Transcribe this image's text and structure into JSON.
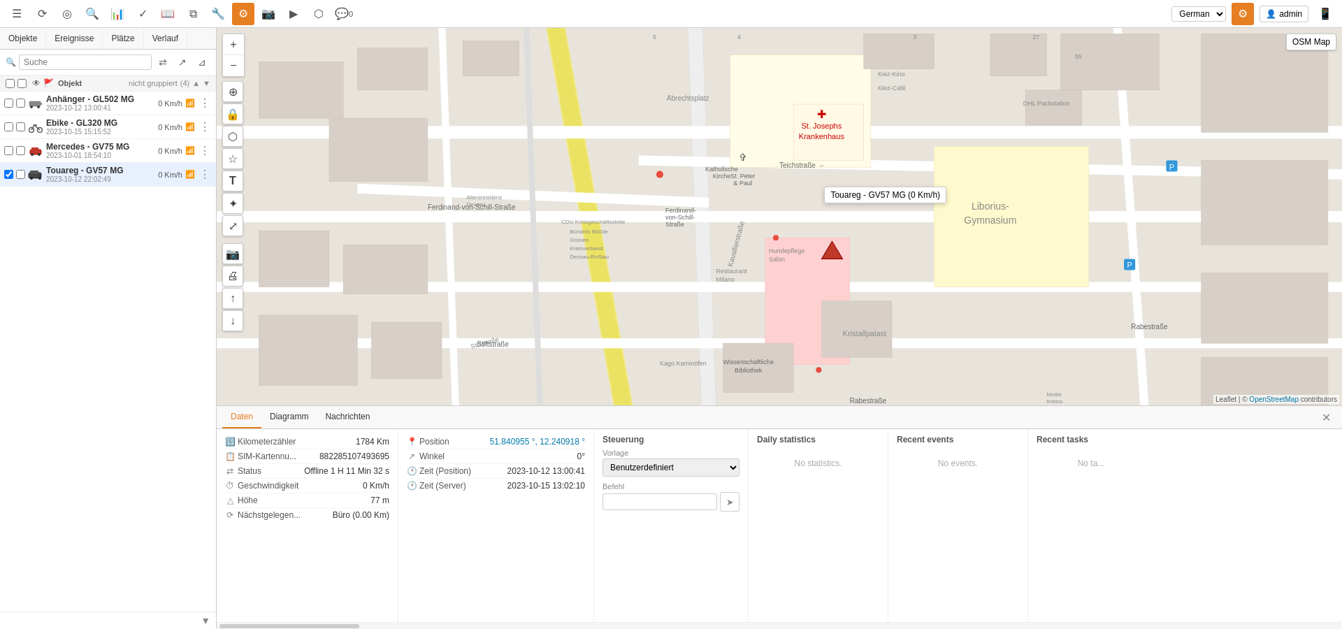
{
  "toolbar": {
    "icons": [
      {
        "name": "menu-icon",
        "symbol": "☰"
      },
      {
        "name": "history-icon",
        "symbol": "⟳"
      },
      {
        "name": "location-icon",
        "symbol": "◎"
      },
      {
        "name": "search-icon",
        "symbol": "🔍"
      },
      {
        "name": "chart-icon",
        "symbol": "📊"
      },
      {
        "name": "check-icon",
        "symbol": "✓"
      },
      {
        "name": "book-icon",
        "symbol": "📖"
      },
      {
        "name": "layers-icon",
        "symbol": "⧉"
      },
      {
        "name": "tools-icon",
        "symbol": "⚙"
      },
      {
        "name": "camera-icon",
        "symbol": "📷"
      },
      {
        "name": "video-icon",
        "symbol": "▶"
      },
      {
        "name": "shape-icon",
        "symbol": "⬡"
      },
      {
        "name": "chat-icon",
        "symbol": "💬"
      },
      {
        "name": "chat-count",
        "symbol": "0"
      }
    ],
    "language": "German",
    "active_icon": "⚙",
    "user": "admin",
    "user_icon": "👤",
    "mobile_icon": "📱"
  },
  "sidebar": {
    "tabs": [
      "Objekte",
      "Ereignisse",
      "Plätze",
      "Verlauf"
    ],
    "search_placeholder": "Suche",
    "list_header": {
      "label": "Objekt",
      "group_label": "nicht gruppiert",
      "group_count": "(4)"
    },
    "objects": [
      {
        "name": "Anhänger - GL502 MG",
        "date": "2023-10-12 13:00:41",
        "speed": "0 Km/h",
        "icon_color": "#888",
        "icon_type": "trailer"
      },
      {
        "name": "Ebike - GL320 MG",
        "date": "2023-10-15 15:15:52",
        "speed": "0 Km/h",
        "icon_color": "#555",
        "icon_type": "bike"
      },
      {
        "name": "Mercedes - GV75 MG",
        "date": "2023-10-01 18:54:10",
        "speed": "0 Km/h",
        "icon_color": "#c0392b",
        "icon_type": "car"
      },
      {
        "name": "Touareg - GV57 MG",
        "date": "2023-10-12 22:02:49",
        "speed": "0 Km/h",
        "icon_color": "#333",
        "icon_type": "suv",
        "selected": true
      }
    ]
  },
  "map": {
    "tooltip": "Touareg - GV57 MG (0 Km/h)",
    "layer_label": "OSM Map",
    "attribution": "Leaflet | © OpenStreetMap contributors"
  },
  "bottom_panel": {
    "tabs": [
      "Daten",
      "Diagramm",
      "Nachrichten"
    ],
    "active_tab": "Daten",
    "data": {
      "kilometerzaehler_label": "Kilometerzähler",
      "kilometerzaehler_value": "1784 Km",
      "sim_label": "SIM-Kartennu...",
      "sim_value": "882285107493695",
      "status_label": "Status",
      "status_value": "Offline 1 H 11 Min 32 s",
      "geschwindigkeit_label": "Geschwindigkeit",
      "geschwindigkeit_value": "0 Km/h",
      "hoehe_label": "Höhe",
      "hoehe_value": "77 m",
      "naechstgelegen_label": "Nächstgelegen...",
      "naechstgelegen_value": "Büro (0.00 Km)"
    },
    "position": {
      "position_label": "Position",
      "position_value": "51.840955 °, 12.240918 °",
      "winkel_label": "Winkel",
      "winkel_value": "0°",
      "zeit_position_label": "Zeit (Position)",
      "zeit_position_value": "2023-10-12 13:00:41",
      "zeit_server_label": "Zeit (Server)",
      "zeit_server_value": "2023-10-15 13:02:10"
    },
    "steuerung": {
      "title": "Steuerung",
      "vorlage_label": "Vorlage",
      "vorlage_value": "Benutzerdefiniert",
      "befehl_label": "Befehl"
    },
    "daily_statistics": {
      "title": "Daily statistics",
      "no_data": "No statistics."
    },
    "recent_events": {
      "title": "Recent events",
      "no_data": "No events."
    },
    "recent_tasks": {
      "title": "Recent tasks",
      "no_data": "No ta..."
    }
  }
}
